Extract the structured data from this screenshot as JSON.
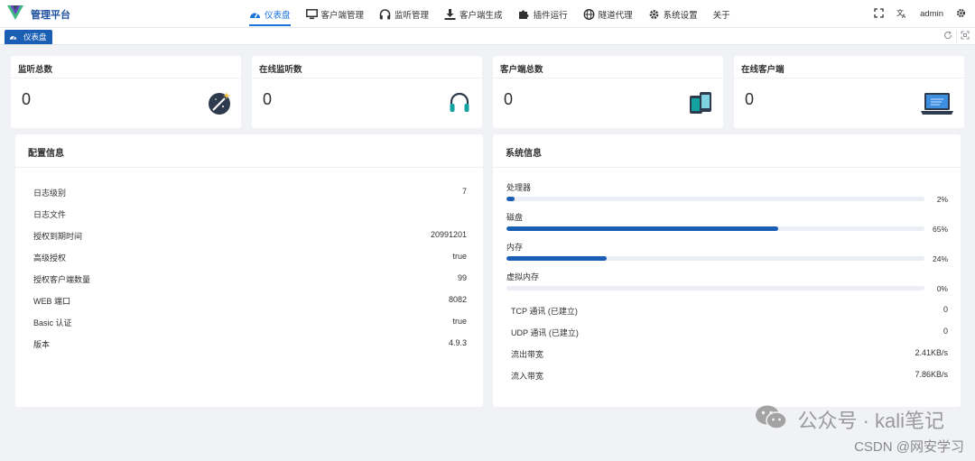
{
  "app": {
    "title": "管理平台"
  },
  "nav": [
    {
      "label": "仪表盘",
      "icon": "dashboard-icon",
      "active": true
    },
    {
      "label": "客户端管理",
      "icon": "monitor-icon"
    },
    {
      "label": "监听管理",
      "icon": "headphones-icon"
    },
    {
      "label": "客户端生成",
      "icon": "download-icon"
    },
    {
      "label": "插件运行",
      "icon": "puzzle-icon"
    },
    {
      "label": "隧道代理",
      "icon": "globe-icon"
    },
    {
      "label": "系统设置",
      "icon": "gear-icon"
    },
    {
      "label": "关于",
      "icon": ""
    }
  ],
  "header": {
    "user": "admin"
  },
  "tags": {
    "active": "仪表盘"
  },
  "stats": [
    {
      "title": "监听总数",
      "value": "0",
      "icon": "magic-wand-icon"
    },
    {
      "title": "在线监听数",
      "value": "0",
      "icon": "headset-icon"
    },
    {
      "title": "客户端总数",
      "value": "0",
      "icon": "devices-icon"
    },
    {
      "title": "在线客户端",
      "value": "0",
      "icon": "laptop-icon"
    }
  ],
  "config": {
    "title": "配置信息",
    "rows": [
      {
        "key": "日志级别",
        "value": "7"
      },
      {
        "key": "日志文件",
        "value": ""
      },
      {
        "key": "授权到期时间",
        "value": "20991201"
      },
      {
        "key": "高级授权",
        "value": "true"
      },
      {
        "key": "授权客户端数量",
        "value": "99"
      },
      {
        "key": "WEB 端口",
        "value": "8082"
      },
      {
        "key": "Basic 认证",
        "value": "true"
      },
      {
        "key": "版本",
        "value": "4.9.3"
      }
    ]
  },
  "system": {
    "title": "系统信息",
    "progress": [
      {
        "label": "处理器",
        "percent": 2,
        "text": "2%"
      },
      {
        "label": "磁盘",
        "percent": 65,
        "text": "65%"
      },
      {
        "label": "内存",
        "percent": 24,
        "text": "24%"
      },
      {
        "label": "虚拟内存",
        "percent": 0,
        "text": "0%"
      }
    ],
    "rows": [
      {
        "key": "TCP 通讯 (已建立)",
        "value": "0"
      },
      {
        "key": "UDP 通讯 (已建立)",
        "value": "0"
      },
      {
        "key": "流出带宽",
        "value": "2.41KB/s"
      },
      {
        "key": "流入带宽",
        "value": "7.86KB/s"
      }
    ]
  },
  "watermark": {
    "text": "公众号 · kali笔记",
    "csdn": "CSDN @网安学习"
  },
  "colors": {
    "accent": "#1a5fb4",
    "nav_active": "#1a73d9",
    "teal": "#13a3a0"
  }
}
